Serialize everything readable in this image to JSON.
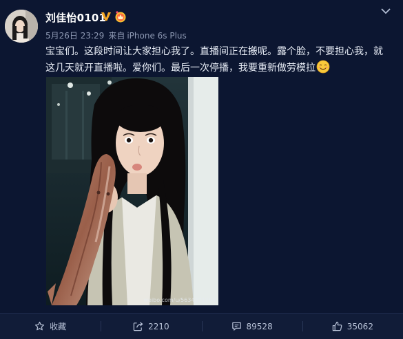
{
  "post": {
    "username": "刘佳怡0101",
    "date": "5月26日 23:29",
    "source_prefix": "来自",
    "device": "iPhone 6s Plus",
    "line1": "宝宝们。这段时间让大家担心我了。直播间正在搬呢。露个脸，不要担心我，就",
    "line2": "这几天就开直播啦。爱你们。最后一次停播，我要重新做劳模拉",
    "watermark": "weibo.com/u/5634271764"
  },
  "actions": {
    "favorite": "收藏",
    "repost_count": "2210",
    "comment_count": "89528",
    "like_count": "35062"
  },
  "icons": {
    "verified": "verified-v-icon",
    "member": "member-crown-icon",
    "more": "chevron-down-icon",
    "emoji": "smiling-face-icon",
    "favorite": "star-icon",
    "repost": "share-arrow-icon",
    "comment": "comment-bubble-icon",
    "like": "thumbs-up-icon"
  },
  "colors": {
    "background": "#0c1631",
    "verified": "#f5a623",
    "text": "#e9eef7",
    "meta": "#8e99b3"
  }
}
